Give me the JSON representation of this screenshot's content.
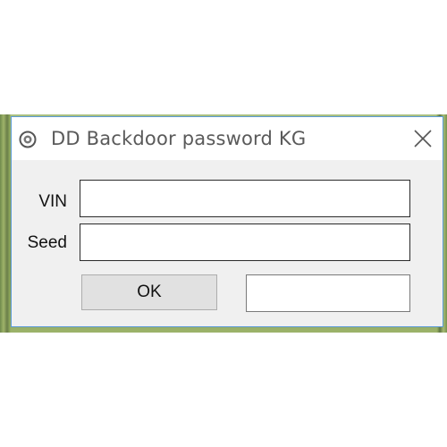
{
  "window": {
    "title": "DD Backdoor password KG",
    "app_icon": "app-logo-icon",
    "close_icon": "close-icon"
  },
  "form": {
    "vin_label": "VIN",
    "vin_value": "",
    "seed_label": "Seed",
    "seed_value": "",
    "ok_label": "OK",
    "result_value": ""
  },
  "colors": {
    "window_border": "#5a9ad5",
    "client_bg": "#f0f0f0",
    "button_bg": "#e1e1e1"
  }
}
